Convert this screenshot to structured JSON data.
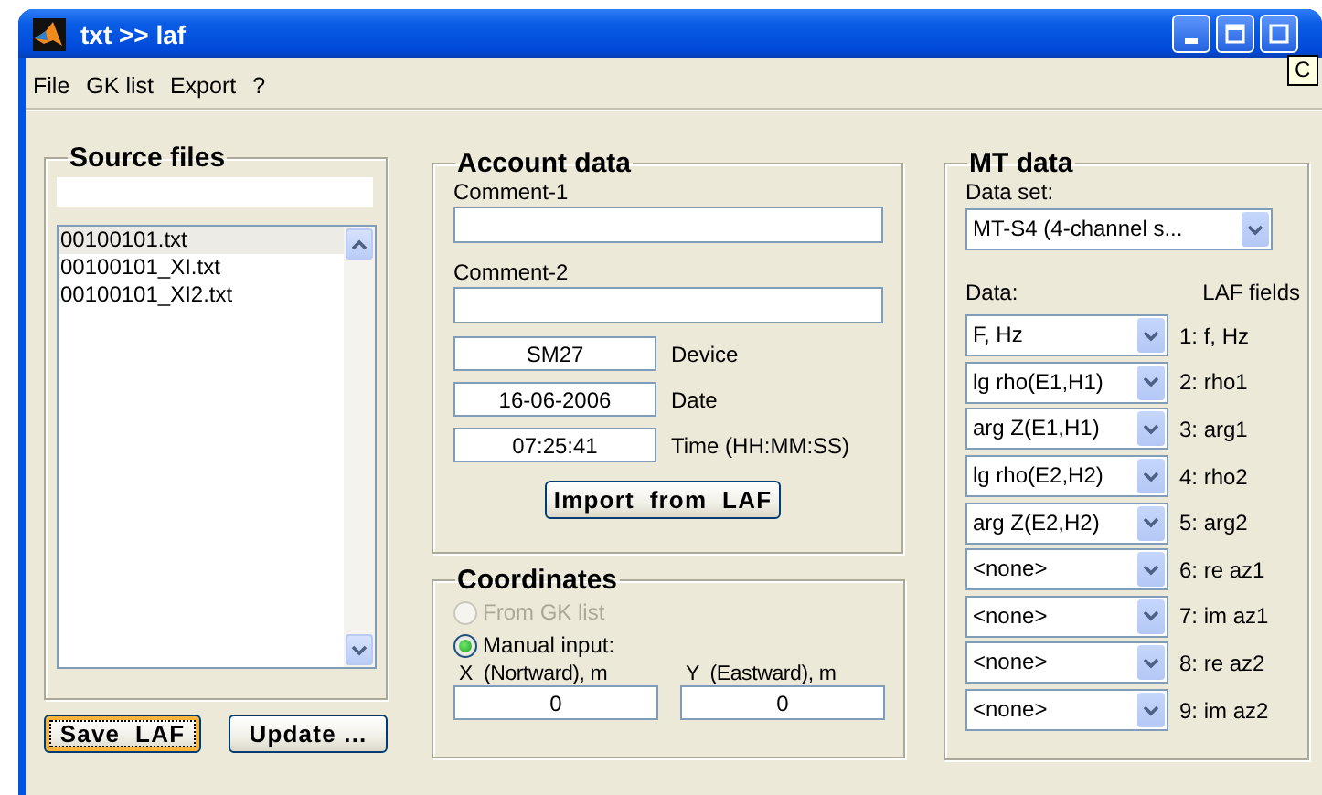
{
  "window": {
    "title": "txt >> laf",
    "tooltip": "C"
  },
  "menu": [
    {
      "label": "File"
    },
    {
      "label": "GK list"
    },
    {
      "label": "Export"
    },
    {
      "label": "?"
    }
  ],
  "source_files": {
    "title": "Source files",
    "files": [
      {
        "name": "00100101.txt",
        "selected": true
      },
      {
        "name": "00100101_XI.txt",
        "selected": false
      },
      {
        "name": "00100101_XI2.txt",
        "selected": false
      }
    ],
    "buttons": [
      {
        "label": "Save  LAF",
        "focused": true
      },
      {
        "label": "Update ...",
        "focused": false
      }
    ]
  },
  "account_data": {
    "title": "Account data",
    "comments": [
      {
        "label": "Comment-1"
      },
      {
        "label": "Comment-2"
      }
    ],
    "fields": [
      {
        "value": "SM27",
        "label": "Device"
      },
      {
        "value": "16-06-2006",
        "label": "Date"
      },
      {
        "value": "07:25:41",
        "label": "Time (HH:MM:SS)"
      }
    ],
    "import_button": "Import  from  LAF"
  },
  "coordinates": {
    "title": "Coordinates",
    "options": [
      {
        "label": "From GK list",
        "selected": false,
        "disabled": true
      },
      {
        "label": "Manual input:",
        "selected": true,
        "disabled": false
      }
    ],
    "inputs": [
      {
        "label": "X  (Nortward), m",
        "value": "0"
      },
      {
        "label": "Y  (Eastward), m",
        "value": "0"
      }
    ]
  },
  "mt_data": {
    "title": "MT data",
    "data_set_label": "Data set:",
    "data_set": "MT-S4 (4-channel s...",
    "data_label": "Data:",
    "fields_label": "LAF fields",
    "rows": [
      {
        "data": "F, Hz",
        "field": "1: f, Hz"
      },
      {
        "data": "lg rho(E1,H1)",
        "field": "2: rho1"
      },
      {
        "data": "arg Z(E1,H1)",
        "field": "3: arg1"
      },
      {
        "data": "lg rho(E2,H2)",
        "field": "4: rho2"
      },
      {
        "data": "arg Z(E2,H2)",
        "field": "5: arg2"
      },
      {
        "data": "<none>",
        "field": "6: re az1"
      },
      {
        "data": "<none>",
        "field": "7: im az1"
      },
      {
        "data": "<none>",
        "field": "8: re az2"
      },
      {
        "data": "<none>",
        "field": "9: im az2"
      }
    ]
  }
}
